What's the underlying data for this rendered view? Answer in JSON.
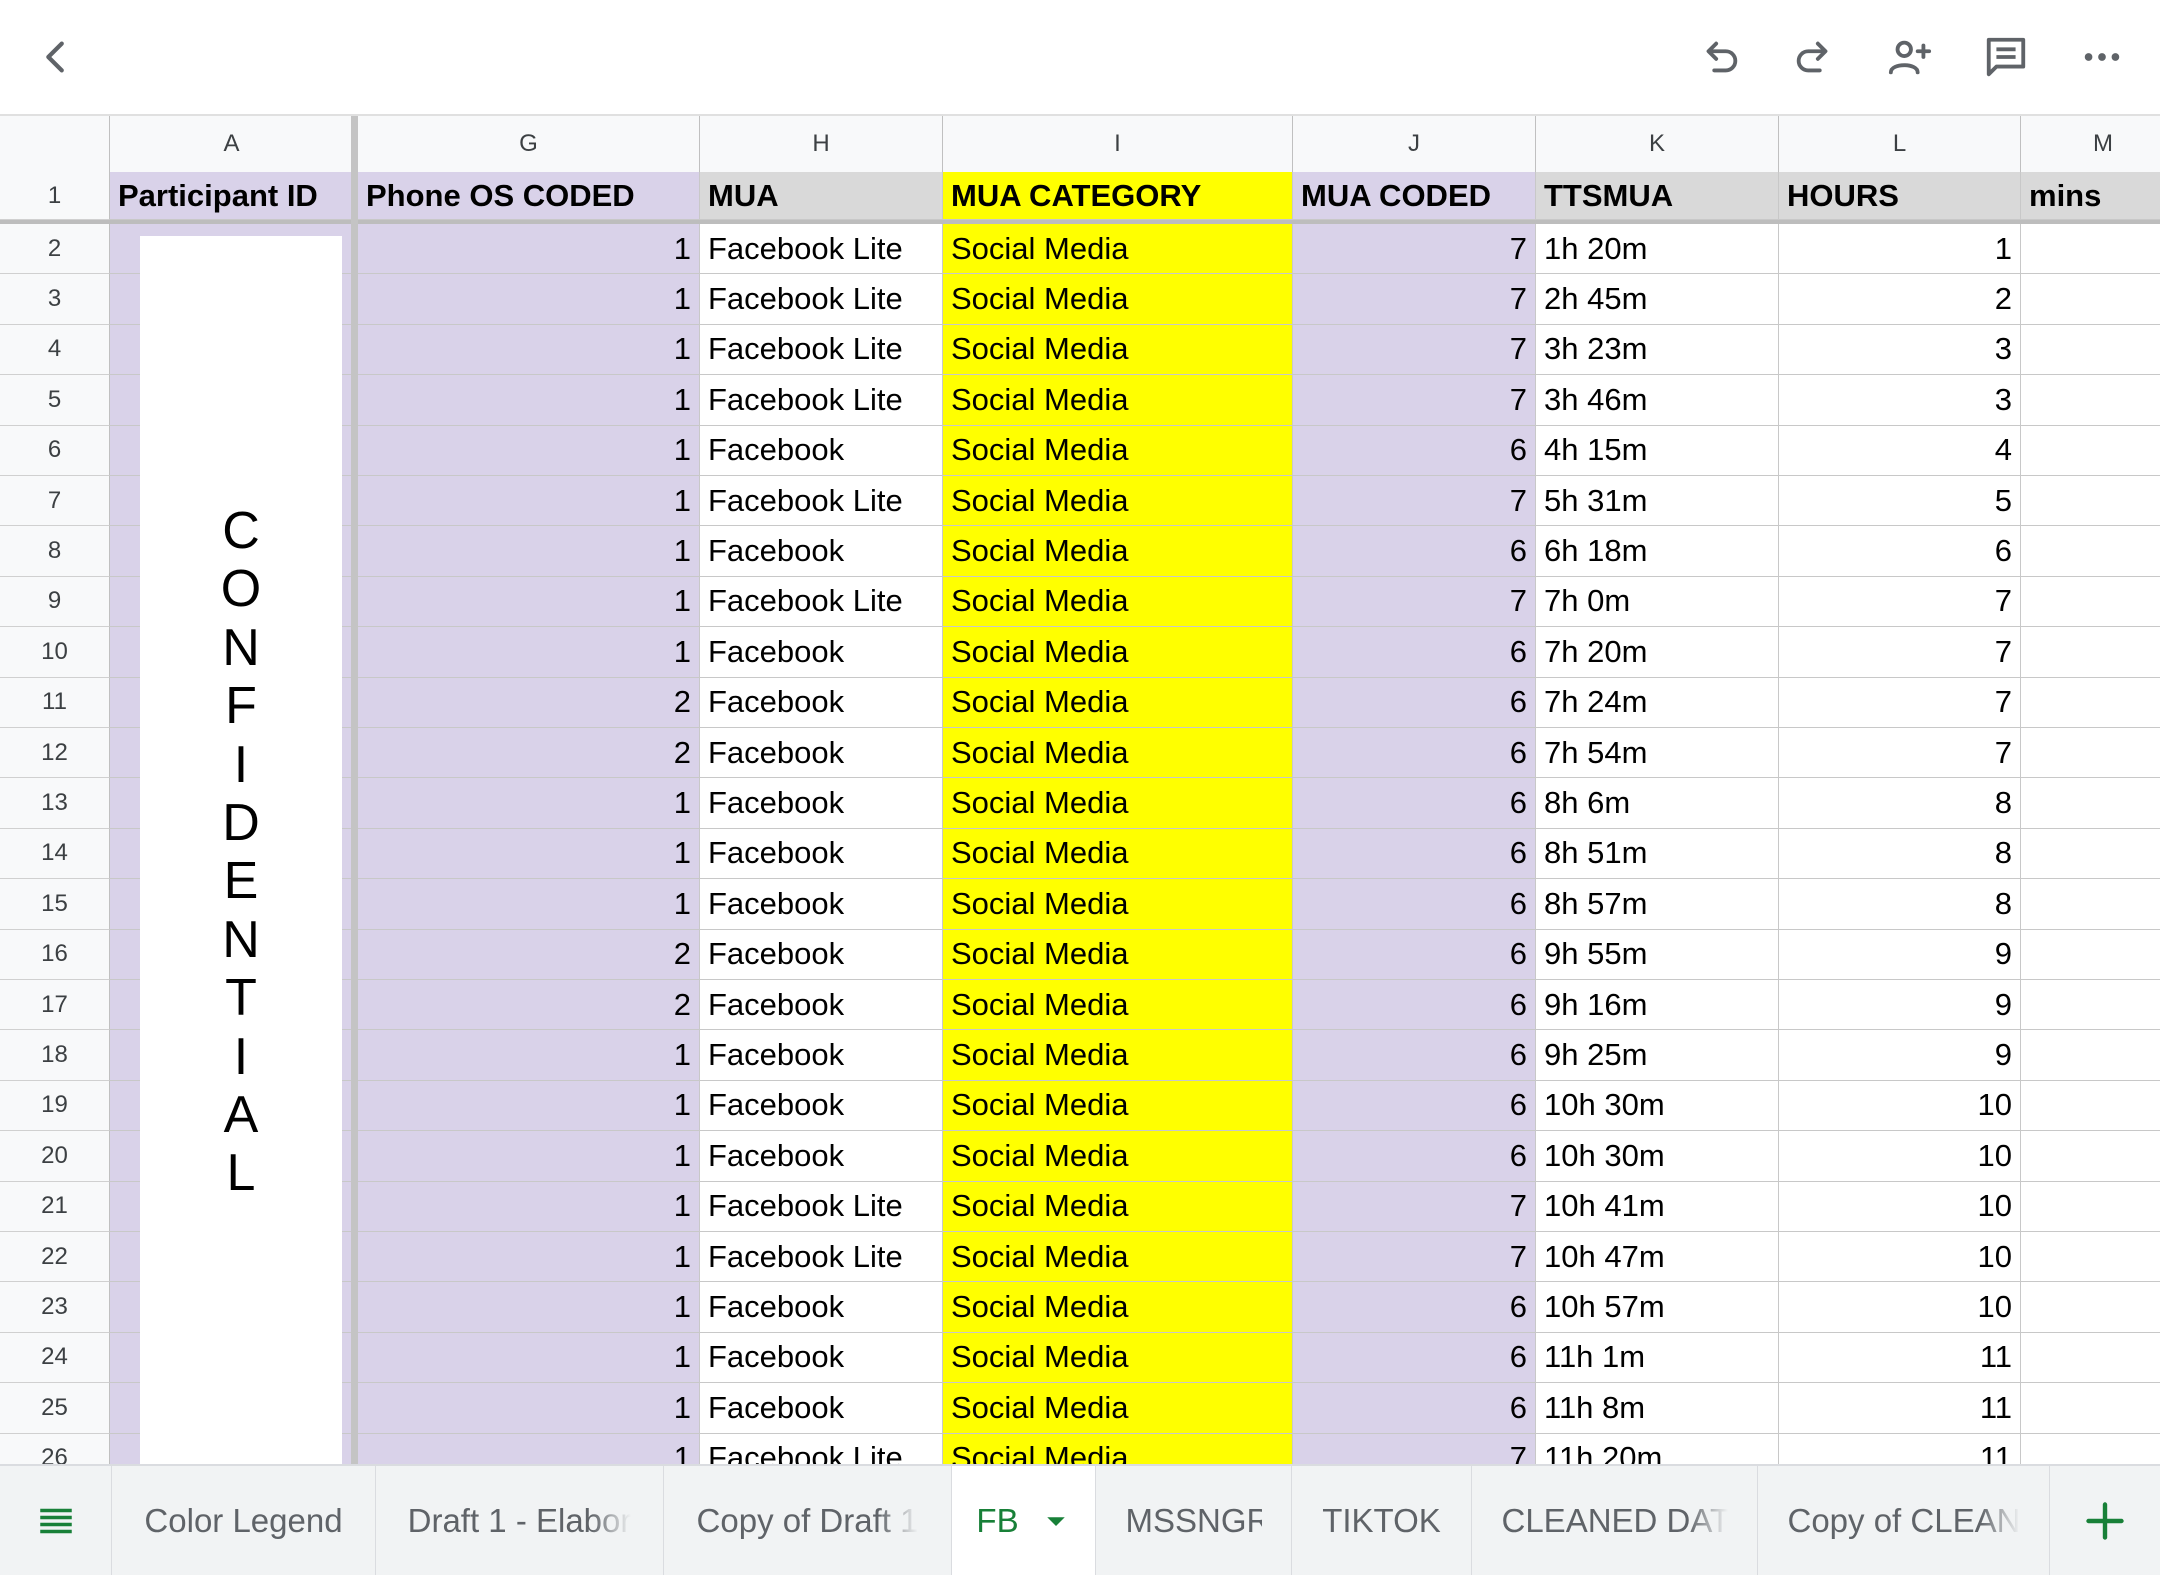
{
  "toolbar": {
    "back_icon": "chevron-left-icon",
    "undo_icon": "undo-icon",
    "redo_icon": "redo-icon",
    "share_icon": "person-add-icon",
    "comment_icon": "comment-icon",
    "more_icon": "more-horizontal-icon"
  },
  "columns": [
    "A",
    "G",
    "H",
    "I",
    "J",
    "K",
    "L",
    "M"
  ],
  "header": {
    "row_number": "1",
    "participant_id": "Participant ID",
    "phone_os_coded": "Phone OS CODED",
    "mua": "MUA",
    "mua_category": "MUA CATEGORY",
    "mua_coded": "MUA CODED",
    "ttsmua": "TTSMUA",
    "hours": "HOURS",
    "mins": "mins"
  },
  "confidential_letters": [
    "C",
    "O",
    "N",
    "F",
    "I",
    "D",
    "E",
    "N",
    "T",
    "I",
    "A",
    "L"
  ],
  "rows": [
    {
      "n": "2",
      "os": "1",
      "mua": "Facebook Lite",
      "cat": "Social Media",
      "coded": "7",
      "tts": "1h 20m",
      "hours": "1"
    },
    {
      "n": "3",
      "os": "1",
      "mua": "Facebook Lite",
      "cat": "Social Media",
      "coded": "7",
      "tts": "2h 45m",
      "hours": "2"
    },
    {
      "n": "4",
      "os": "1",
      "mua": "Facebook Lite",
      "cat": "Social Media",
      "coded": "7",
      "tts": "3h 23m",
      "hours": "3"
    },
    {
      "n": "5",
      "os": "1",
      "mua": "Facebook Lite",
      "cat": "Social Media",
      "coded": "7",
      "tts": "3h 46m",
      "hours": "3"
    },
    {
      "n": "6",
      "os": "1",
      "mua": "Facebook",
      "cat": "Social Media",
      "coded": "6",
      "tts": "4h 15m",
      "hours": "4"
    },
    {
      "n": "7",
      "os": "1",
      "mua": "Facebook Lite",
      "cat": "Social Media",
      "coded": "7",
      "tts": "5h 31m",
      "hours": "5"
    },
    {
      "n": "8",
      "os": "1",
      "mua": "Facebook",
      "cat": "Social Media",
      "coded": "6",
      "tts": "6h 18m",
      "hours": "6"
    },
    {
      "n": "9",
      "os": "1",
      "mua": "Facebook Lite",
      "cat": "Social Media",
      "coded": "7",
      "tts": "7h 0m",
      "hours": "7"
    },
    {
      "n": "10",
      "os": "1",
      "mua": "Facebook",
      "cat": "Social Media",
      "coded": "6",
      "tts": "7h 20m",
      "hours": "7"
    },
    {
      "n": "11",
      "os": "2",
      "mua": "Facebook",
      "cat": "Social Media",
      "coded": "6",
      "tts": "7h 24m",
      "hours": "7"
    },
    {
      "n": "12",
      "os": "2",
      "mua": "Facebook",
      "cat": "Social Media",
      "coded": "6",
      "tts": "7h 54m",
      "hours": "7"
    },
    {
      "n": "13",
      "os": "1",
      "mua": "Facebook",
      "cat": "Social Media",
      "coded": "6",
      "tts": "8h 6m",
      "hours": "8"
    },
    {
      "n": "14",
      "os": "1",
      "mua": "Facebook",
      "cat": "Social Media",
      "coded": "6",
      "tts": "8h 51m",
      "hours": "8"
    },
    {
      "n": "15",
      "os": "1",
      "mua": "Facebook",
      "cat": "Social Media",
      "coded": "6",
      "tts": "8h 57m",
      "hours": "8"
    },
    {
      "n": "16",
      "os": "2",
      "mua": "Facebook",
      "cat": "Social Media",
      "coded": "6",
      "tts": "9h 55m",
      "hours": "9"
    },
    {
      "n": "17",
      "os": "2",
      "mua": "Facebook",
      "cat": "Social Media",
      "coded": "6",
      "tts": "9h 16m",
      "hours": "9"
    },
    {
      "n": "18",
      "os": "1",
      "mua": "Facebook",
      "cat": "Social Media",
      "coded": "6",
      "tts": "9h 25m",
      "hours": "9"
    },
    {
      "n": "19",
      "os": "1",
      "mua": "Facebook",
      "cat": "Social Media",
      "coded": "6",
      "tts": "10h 30m",
      "hours": "10"
    },
    {
      "n": "20",
      "os": "1",
      "mua": "Facebook",
      "cat": "Social Media",
      "coded": "6",
      "tts": "10h 30m",
      "hours": "10"
    },
    {
      "n": "21",
      "os": "1",
      "mua": "Facebook Lite",
      "cat": "Social Media",
      "coded": "7",
      "tts": "10h 41m",
      "hours": "10"
    },
    {
      "n": "22",
      "os": "1",
      "mua": "Facebook Lite",
      "cat": "Social Media",
      "coded": "7",
      "tts": "10h 47m",
      "hours": "10"
    },
    {
      "n": "23",
      "os": "1",
      "mua": "Facebook",
      "cat": "Social Media",
      "coded": "6",
      "tts": "10h 57m",
      "hours": "10"
    },
    {
      "n": "24",
      "os": "1",
      "mua": "Facebook",
      "cat": "Social Media",
      "coded": "6",
      "tts": "11h 1m",
      "hours": "11"
    },
    {
      "n": "25",
      "os": "1",
      "mua": "Facebook",
      "cat": "Social Media",
      "coded": "6",
      "tts": "11h 8m",
      "hours": "11"
    },
    {
      "n": "26",
      "os": "1",
      "mua": "Facebook Lite",
      "cat": "Social Media",
      "coded": "7",
      "tts": "11h 20m",
      "hours": "11"
    }
  ],
  "tabs": [
    {
      "label": "Color Legend",
      "active": false
    },
    {
      "label": "Draft 1 - Elabor",
      "active": false
    },
    {
      "label": "Copy of Draft 1",
      "active": false
    },
    {
      "label": "FB",
      "active": true
    },
    {
      "label": "MSSNGR",
      "active": false
    },
    {
      "label": "TIKTOK",
      "active": false
    },
    {
      "label": "CLEANED DATA",
      "active": false
    },
    {
      "label": "Copy of CLEAN",
      "active": false
    }
  ],
  "colors": {
    "lavender": "#d9d2e9",
    "yellow": "#ffff00",
    "grey": "#d9d9d9",
    "active_tab": "#188038"
  }
}
